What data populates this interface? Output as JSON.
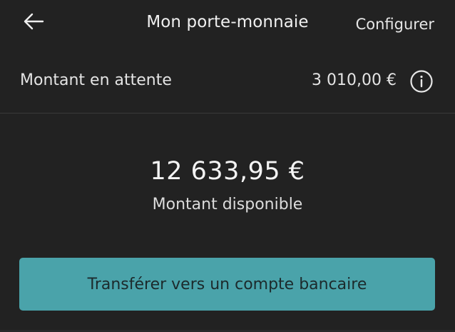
{
  "header": {
    "back_icon": "arrow-left-icon",
    "title": "Mon porte-monnaie",
    "configure_label": "Configurer"
  },
  "pending": {
    "label": "Montant en attente",
    "amount": "3 010,00 €",
    "info_icon": "info-circle-icon"
  },
  "available": {
    "amount": "12 633,95 €",
    "label": "Montant disponible"
  },
  "actions": {
    "transfer_label": "Transférer vers un compte bancaire"
  },
  "colors": {
    "background": "#222222",
    "accent": "#4aa3aa",
    "text": "#ececec",
    "divider": "#3a3a3a"
  }
}
